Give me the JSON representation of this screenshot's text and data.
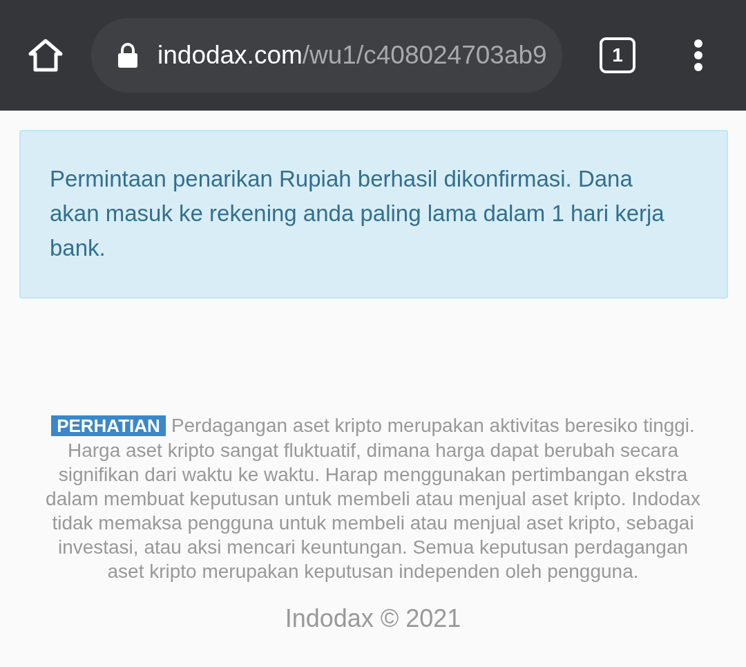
{
  "toolbar": {
    "url": {
      "host": "indodax.com",
      "path": "/wu1/c408024703ab9",
      "secure": true
    },
    "tab_count": "1"
  },
  "alert": {
    "text": "Permintaan penarikan Rupiah berhasil dikonfirmasi. Dana akan masuk ke rekening anda paling lama dalam 1 hari kerja bank."
  },
  "disclaimer": {
    "badge": "PERHATIAN",
    "text": "Perdagangan aset kripto merupakan aktivitas beresiko tinggi. Harga aset kripto sangat fluktuatif, dimana harga dapat berubah secara signifikan dari waktu ke waktu. Harap menggunakan pertimbangan ekstra dalam membuat keputusan untuk membeli atau menjual aset kripto. Indodax tidak memaksa pengguna untuk membeli atau menjual aset kripto, sebagai investasi, atau aksi mencari keuntungan. Semua keputusan perdagangan aset kripto merupakan keputusan independen oleh pengguna."
  },
  "copyright": "Indodax © 2021"
}
